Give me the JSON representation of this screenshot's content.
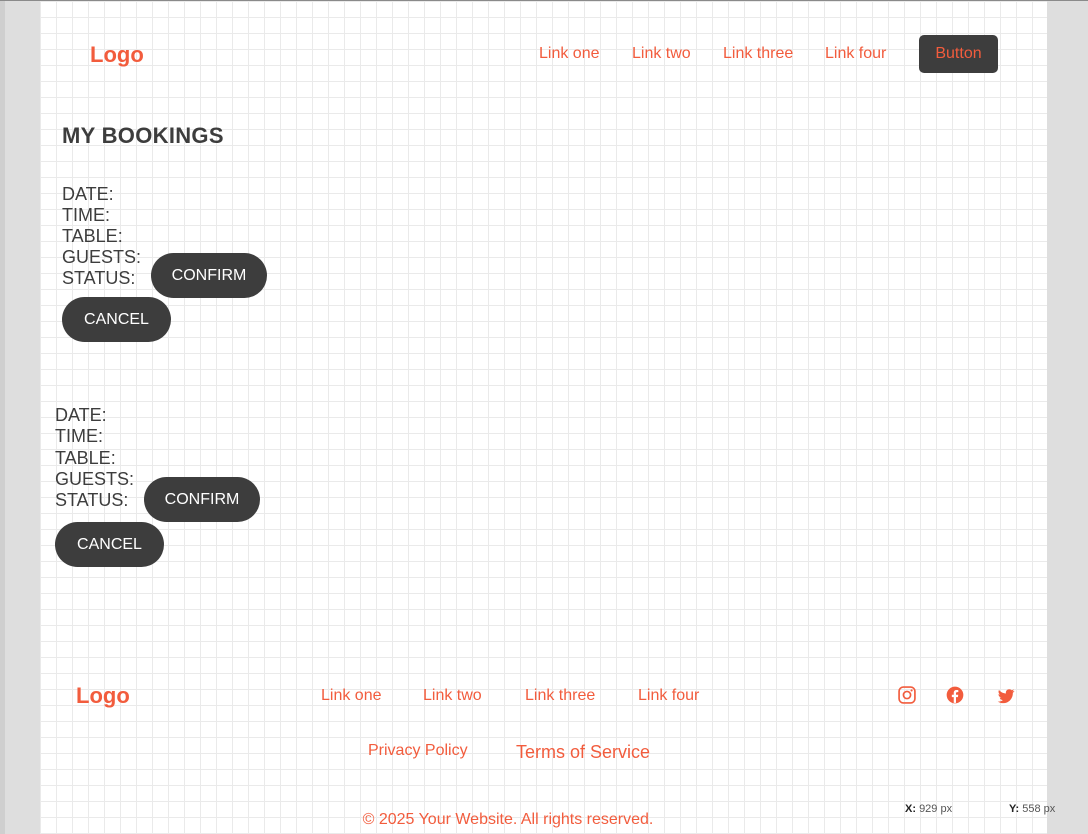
{
  "header": {
    "logo": "Logo",
    "nav": [
      "Link one",
      "Link two",
      "Link three",
      "Link four"
    ],
    "button_label": "Button"
  },
  "main": {
    "title": "MY BOOKINGS",
    "bookings": [
      {
        "labels": [
          "DATE:",
          "TIME:",
          "TABLE:",
          "GUESTS:",
          "STATUS:"
        ],
        "confirm_label": "CONFIRM",
        "cancel_label": "CANCEL"
      },
      {
        "labels": [
          "DATE:",
          "TIME:",
          "TABLE:",
          "GUESTS:",
          "STATUS:"
        ],
        "confirm_label": "CONFIRM",
        "cancel_label": "CANCEL"
      }
    ]
  },
  "footer": {
    "logo": "Logo",
    "nav": [
      "Link one",
      "Link two",
      "Link three",
      "Link four"
    ],
    "social_icons": [
      "instagram-icon",
      "facebook-icon",
      "twitter-icon"
    ],
    "privacy_label": "Privacy Policy",
    "terms_label": "Terms of Service",
    "copyright": "© 2025 Your Website. All rights reserved."
  },
  "overlay": {
    "x_label": "X:",
    "x_value": "929 px",
    "y_label": "Y:",
    "y_value": "558 px"
  },
  "colors": {
    "accent": "#f25c3d",
    "dark": "#3d3d3d",
    "grid": "#eaeaea"
  }
}
